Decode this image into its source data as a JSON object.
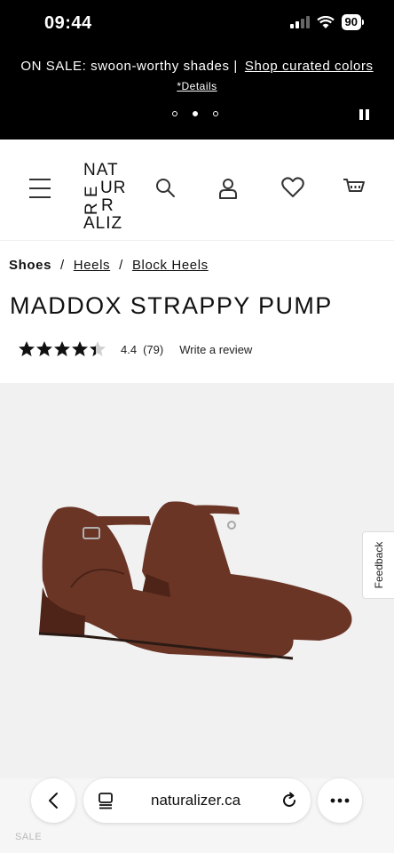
{
  "status_bar": {
    "time": "09:44",
    "battery": "90"
  },
  "promo": {
    "text": "ON SALE: swoon-worthy shades |",
    "link": "Shop curated colors",
    "details": "*Details",
    "slide_count": 3,
    "active_slide": 2
  },
  "header": {
    "logo_lines": [
      "NAT",
      "UR",
      "ALIZ",
      "ER"
    ]
  },
  "breadcrumb": [
    "Shoes",
    "/",
    "Heels",
    "/",
    "Block Heels"
  ],
  "product": {
    "title": "MADDOX STRAPPY PUMP",
    "rating_value": "4.4",
    "rating_count": "(79)",
    "rating_stars": 4.4,
    "write_review": "Write a review",
    "shoe_color": "#6b3526"
  },
  "feedback": {
    "label": "Feedback"
  },
  "browser": {
    "url": "naturalizer.ca"
  },
  "footer_hint": {
    "text": "SALE"
  }
}
